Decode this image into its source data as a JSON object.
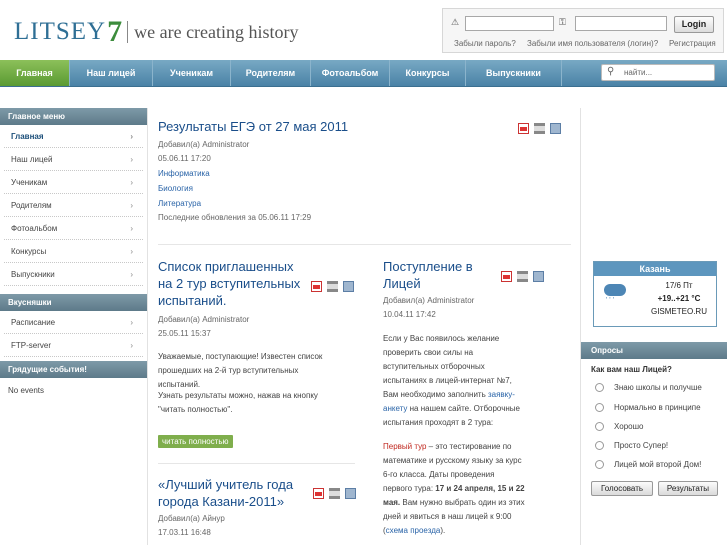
{
  "header": {
    "logo_text": "LITSEY",
    "logo_number": "7",
    "slogan": "we are creating history"
  },
  "login": {
    "username_icon": "warning-icon",
    "password_icon": "key-icon",
    "button": "Login",
    "forgot_password": "Забыли пароль?",
    "forgot_username": "Забыли имя пользователя (логин)?",
    "register": "Регистрация"
  },
  "nav": {
    "items": [
      "Главная",
      "Наш лицей",
      "Ученикам",
      "Родителям",
      "Фотоальбом",
      "Конкурсы",
      "Выпускники"
    ],
    "search_placeholder": "найти..."
  },
  "sidebar": {
    "main_menu_title": "Главное меню",
    "items": [
      "Главная",
      "Наш лицей",
      "Ученикам",
      "Родителям",
      "Фотоальбом",
      "Конкурсы",
      "Выпускники"
    ],
    "goodies_title": "Вкусняшки",
    "goodies": [
      "Расписание",
      "FTP-server"
    ],
    "events_title": "Грядущие события!",
    "no_events": "No events"
  },
  "articles": {
    "a1": {
      "title": "Результаты ЕГЭ от 27 мая 2011",
      "author": "Добавил(а) Administrator",
      "date": "05.06.11 17:20",
      "links": [
        "Информатика",
        "Биология",
        "Литература"
      ],
      "updated": "Последние обновления за 05.06.11 17:29"
    },
    "a2": {
      "title_lines": [
        "Список приглашенных",
        "на 2 тур вступительных",
        "испытаний."
      ],
      "author": "Добавил(а) Administrator",
      "date": "25.05.11 15:37",
      "body_lines": [
        "Уважаемые, поступающие! Известен список",
        "прошедших на 2-й тур вступительных",
        "испытаний."
      ],
      "results_lines": [
        "Узнать результаты можно, нажав на кнопку",
        "\"читать полностью\"."
      ],
      "read_more": "читать полностью"
    },
    "a3": {
      "title_lines": [
        "«Лучший учитель года",
        "города Казани-2011»"
      ],
      "author": "Добавил(а) Айнур",
      "date": "17.03.11 16:48"
    },
    "a4": {
      "title_lines": [
        "Поступление в",
        "Лицей"
      ],
      "author": "Добавил(а) Administrator",
      "date": "10.04.11 17:42",
      "p1_a": "Если у Вас появилось желание",
      "p1_b": "проверить свои силы на",
      "p1_c": "вступительных отборочных",
      "p1_d": "испытаниях в лицей-интернат №7,",
      "p1_e": "Вам необходимо заполнить ",
      "p1_link1": "заявку-",
      "p1_link2": "анкету",
      "p1_f": " на нашем сайте. Отборочные",
      "p1_g": "испытания проходят в 2 тура:",
      "p2_red": "Первый тур",
      "p2_a": " – это тестирование по",
      "p2_b": "математике и русскому языку за курс",
      "p2_c": "6-го класса. Даты проведения",
      "p2_d": "первого тура: ",
      "p2_bold1": "17 и 24 апреля, 15 и 22",
      "p2_bold2": "мая.",
      "p2_e": " Вам нужно выбрать один из этих",
      "p2_f": "дней и явиться в наш лицей к 9:00",
      "p2_g_open": "(",
      "p2_g_link": "схема проезда",
      "p2_g_close": ")."
    }
  },
  "weather": {
    "city": "Казань",
    "date": "17/6 Пт",
    "temp": "+19..+21 °C",
    "source": "GISMETEO.RU",
    "icon": "rain-cloud-icon"
  },
  "poll": {
    "title": "Опросы",
    "question": "Как вам наш Лицей?",
    "options": [
      "Знаю школы и получше",
      "Нормально в принципе",
      "Хорошо",
      "Просто Супер!",
      "Лицей мой второй Дом!"
    ],
    "vote_button": "Голосовать",
    "results_button": "Результаты"
  }
}
